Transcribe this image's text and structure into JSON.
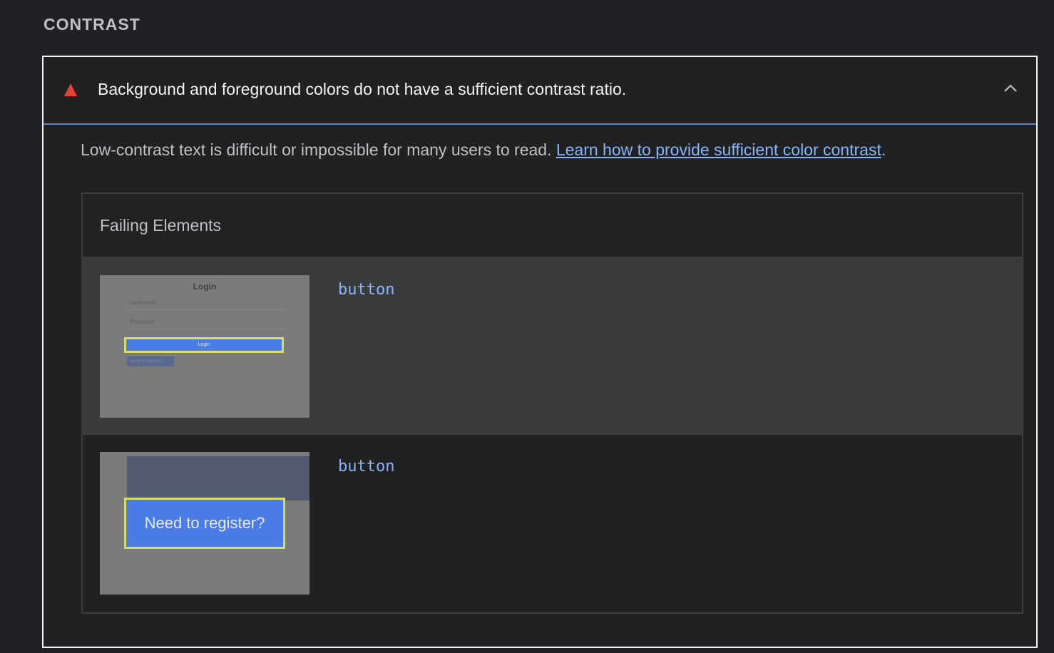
{
  "section": {
    "title": "CONTRAST"
  },
  "audit": {
    "status_icon": "warning-triangle-icon",
    "status_color": "#e94235",
    "title": "Background and foreground colors do not have a sufficient contrast ratio.",
    "toggle_icon": "chevron-up-icon",
    "description": "Low-contrast text is difficult or impossible for many users to read. ",
    "link_text": "Learn how to provide sufficient color contrast",
    "description_end": "."
  },
  "failing_elements": {
    "header": "Failing Elements",
    "rows": [
      {
        "node": "button",
        "thumbnail": {
          "title": "Login",
          "username_placeholder": "Username",
          "password_placeholder": "Password",
          "highlighted_button": "Login",
          "secondary_button": "Need to register?"
        }
      },
      {
        "node": "button",
        "thumbnail": {
          "highlighted_button": "Need to register?"
        }
      }
    ]
  },
  "colors": {
    "background": "#202124",
    "link": "#8ab4f8",
    "highlight": "#d7de62",
    "button_blue": "#4a7be6"
  }
}
